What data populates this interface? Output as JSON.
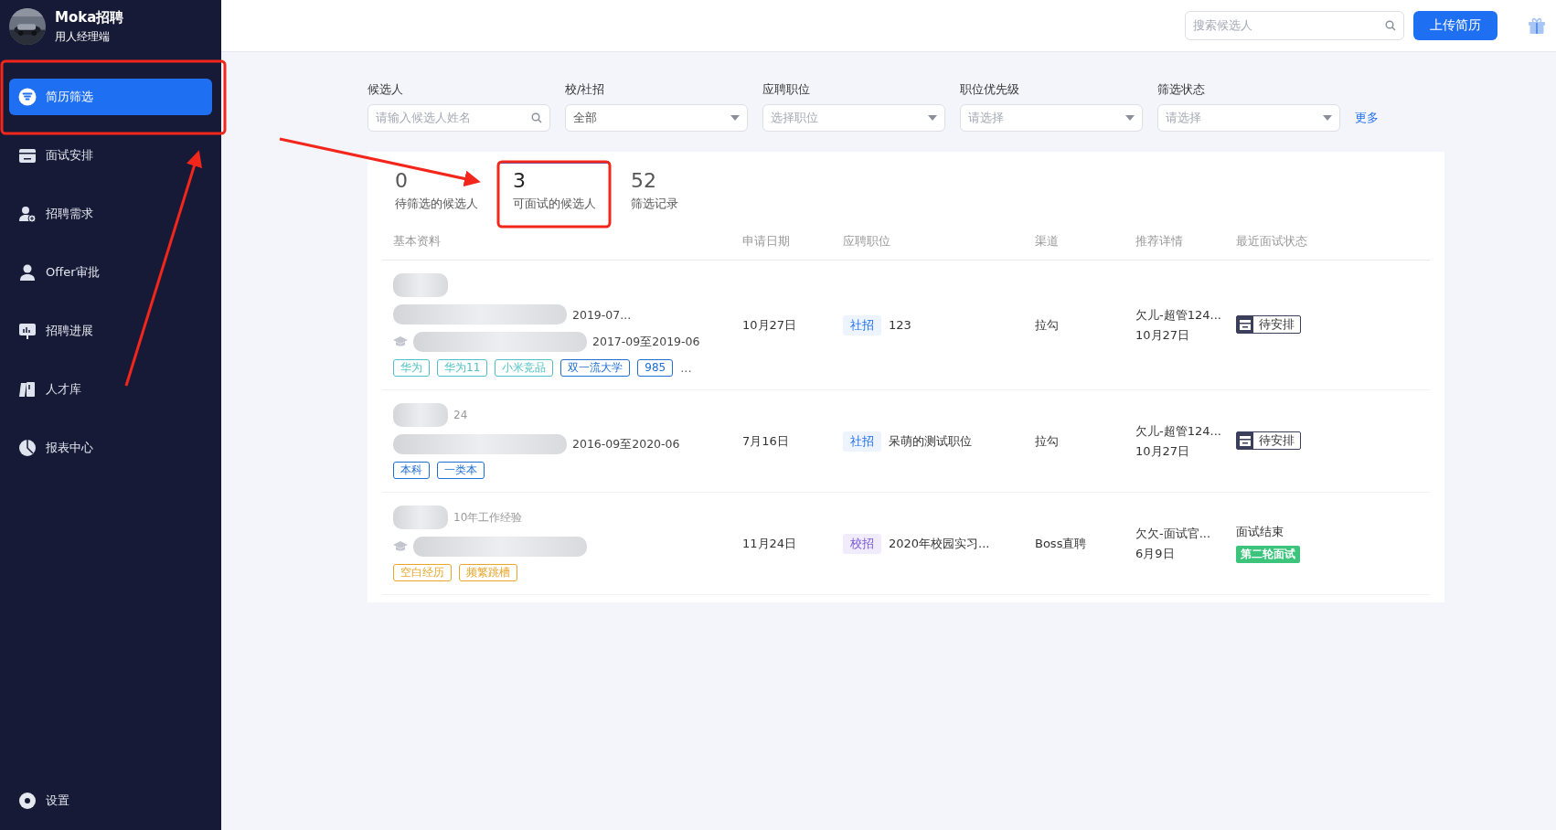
{
  "brand": {
    "name": "Moka招聘",
    "subtitle": "用人经理端"
  },
  "nav": [
    {
      "label": "简历筛选",
      "selected": true
    },
    {
      "label": "面试安排",
      "selected": false
    },
    {
      "label": "招聘需求",
      "selected": false
    },
    {
      "label": "Offer审批",
      "selected": false
    },
    {
      "label": "招聘进展",
      "selected": false
    },
    {
      "label": "人才库",
      "selected": false
    },
    {
      "label": "报表中心",
      "selected": false
    }
  ],
  "settings": {
    "label": "设置"
  },
  "header": {
    "search_placeholder": "搜索候选人",
    "upload_button": "上传简历"
  },
  "filters": [
    {
      "label": "候选人",
      "kind": "search",
      "placeholder": "请输入候选人姓名"
    },
    {
      "label": "校/社招",
      "kind": "select",
      "value": "全部"
    },
    {
      "label": "应聘职位",
      "kind": "select",
      "placeholder": "选择职位"
    },
    {
      "label": "职位优先级",
      "kind": "select",
      "placeholder": "请选择"
    },
    {
      "label": "筛选状态",
      "kind": "select",
      "placeholder": "请选择"
    }
  ],
  "more_link": "更多",
  "tabs": [
    {
      "count": "0",
      "label": "待筛选的候选人",
      "selected": false
    },
    {
      "count": "3",
      "label": "可面试的候选人",
      "selected": true
    },
    {
      "count": "52",
      "label": "筛选记录",
      "selected": false
    }
  ],
  "table": {
    "columns": [
      "基本资料",
      "申请日期",
      "应聘职位",
      "渠道",
      "推荐详情",
      "最近面试状态"
    ],
    "rows": [
      {
        "meta": [],
        "lines": [
          {
            "kind": "work",
            "text": "2019-07..."
          },
          {
            "kind": "education",
            "text": "2017-09至2019-06"
          }
        ],
        "tags": [
          {
            "text": "华为",
            "color": "#4fc1c6"
          },
          {
            "text": "华为11",
            "color": "#4fc1c6"
          },
          {
            "text": "小米竞品",
            "color": "#4fc1c6"
          },
          {
            "text": "双一流大学",
            "color": "#1f6fd1"
          },
          {
            "text": "985",
            "color": "#1f6fd1"
          }
        ],
        "tags_more": "...",
        "date": "10月27日",
        "job_type": {
          "text": "社招",
          "kind": "social"
        },
        "job": "123",
        "channel": "拉勾",
        "referral": [
          "欠儿-超管124...",
          "10月27日"
        ],
        "status": {
          "kind": "pending",
          "text": "待安排"
        }
      },
      {
        "meta": [
          "24"
        ],
        "lines": [
          {
            "kind": "work",
            "text": "2016-09至2020-06"
          }
        ],
        "tags": [
          {
            "text": "本科",
            "color": "#1f6fd1"
          },
          {
            "text": "一类本",
            "color": "#1f6fd1"
          }
        ],
        "date": "7月16日",
        "job_type": {
          "text": "社招",
          "kind": "social"
        },
        "job": "呆萌的测试职位",
        "channel": "拉勾",
        "referral": [
          "欠儿-超管124...",
          "10月27日"
        ],
        "status": {
          "kind": "pending",
          "text": "待安排"
        }
      },
      {
        "meta": [
          "10年工作经验"
        ],
        "lines": [
          {
            "kind": "education"
          }
        ],
        "tags": [
          {
            "text": "空白经历",
            "color": "#e9a62a"
          },
          {
            "text": "频繁跳槽",
            "color": "#e9a62a"
          }
        ],
        "date": "11月24日",
        "job_type": {
          "text": "校招",
          "kind": "campus"
        },
        "job": "2020年校园实习...",
        "channel": "Boss直聘",
        "referral": [
          "欠欠-面试官...",
          "6月9日"
        ],
        "status": {
          "kind": "ended",
          "text": "面试结束",
          "badge": "第二轮面试"
        }
      }
    ]
  }
}
